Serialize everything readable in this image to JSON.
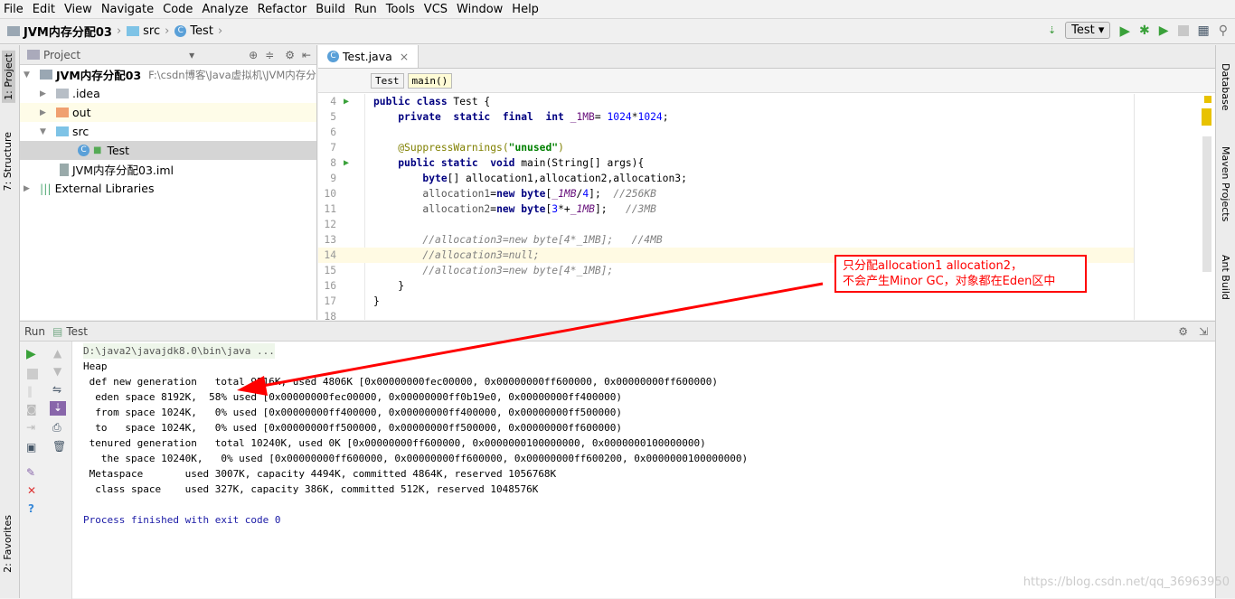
{
  "menu": [
    "File",
    "Edit",
    "View",
    "Navigate",
    "Code",
    "Analyze",
    "Refactor",
    "Build",
    "Run",
    "Tools",
    "VCS",
    "Window",
    "Help"
  ],
  "breadcrumb": [
    "JVM内存分配03",
    "src",
    "Test"
  ],
  "run_config": "Test",
  "left_tabs": [
    "1: Project",
    "7: Structure",
    "2: Favorites"
  ],
  "right_tabs": [
    "Database",
    "Maven Projects",
    "Ant Build"
  ],
  "project": {
    "title": "Project",
    "root": "JVM内存分配03",
    "root_path": "F:\\csdn博客\\Java虚拟机\\JVM内存分",
    "items": [
      ".idea",
      "out",
      "src",
      "Test",
      "JVM内存分配03.iml",
      "External Libraries"
    ]
  },
  "editor": {
    "tab": "Test.java",
    "crumbs": [
      "Test",
      "main()"
    ],
    "lines": [
      {
        "n": "4",
        "run": true,
        "seg": [
          [
            "kw",
            "public class "
          ],
          [
            "",
            "Test {"
          ]
        ]
      },
      {
        "n": "5",
        "seg": [
          [
            "",
            "    "
          ],
          [
            "kw",
            "private  static  final  int "
          ],
          [
            "fld",
            "_1MB"
          ],
          [
            "",
            "= "
          ],
          [
            "num",
            "1024"
          ],
          [
            "",
            "*"
          ],
          [
            "num",
            "1024"
          ],
          [
            "",
            ";"
          ]
        ]
      },
      {
        "n": "6",
        "seg": []
      },
      {
        "n": "7",
        "seg": [
          [
            "",
            "    "
          ],
          [
            "an",
            "@SuppressWarnings("
          ],
          [
            "str",
            "\"unused\""
          ],
          [
            "an",
            ")"
          ]
        ]
      },
      {
        "n": "8",
        "run": true,
        "seg": [
          [
            "",
            "    "
          ],
          [
            "kw",
            "public static  void "
          ],
          [
            "",
            "main(String[] args){"
          ]
        ]
      },
      {
        "n": "9",
        "seg": [
          [
            "",
            "        "
          ],
          [
            "kw",
            "byte"
          ],
          [
            "",
            "[] allocation1,allocation2,allocation3;"
          ]
        ]
      },
      {
        "n": "10",
        "seg": [
          [
            "",
            "        "
          ],
          [
            "gray",
            "allocation1"
          ],
          [
            "",
            "="
          ],
          [
            "kw",
            "new byte"
          ],
          [
            "",
            "["
          ],
          [
            "var",
            "_1MB"
          ],
          [
            "",
            "/"
          ],
          [
            "num",
            "4"
          ],
          [
            "",
            "];  "
          ],
          [
            "cm",
            "//256KB"
          ]
        ]
      },
      {
        "n": "11",
        "seg": [
          [
            "",
            "        "
          ],
          [
            "gray",
            "allocation2"
          ],
          [
            "",
            "="
          ],
          [
            "kw",
            "new byte"
          ],
          [
            "",
            "["
          ],
          [
            "num",
            "3"
          ],
          [
            "",
            "*+"
          ],
          [
            "var",
            "_1MB"
          ],
          [
            "",
            "];   "
          ],
          [
            "cm",
            "//3MB"
          ]
        ]
      },
      {
        "n": "12",
        "seg": []
      },
      {
        "n": "13",
        "seg": [
          [
            "",
            "        "
          ],
          [
            "cm",
            "//allocation3=new byte[4*_1MB];   //4MB"
          ]
        ]
      },
      {
        "n": "14",
        "hl": true,
        "seg": [
          [
            "",
            "        "
          ],
          [
            "cm",
            "//allocation3=null;"
          ]
        ]
      },
      {
        "n": "15",
        "seg": [
          [
            "",
            "        "
          ],
          [
            "cm",
            "//allocation3=new byte[4*_1MB];"
          ]
        ]
      },
      {
        "n": "16",
        "seg": [
          [
            "",
            "    }"
          ]
        ]
      },
      {
        "n": "17",
        "seg": [
          [
            "",
            "}"
          ]
        ]
      },
      {
        "n": "18",
        "seg": []
      }
    ]
  },
  "run": {
    "title": "Run",
    "config": "Test",
    "console": [
      "D:\\java2\\javajdk8.0\\bin\\java ...",
      "Heap",
      " def new generation   total 9216K, used 4806K [0x00000000fec00000, 0x00000000ff600000, 0x00000000ff600000)",
      "  eden space 8192K,  58% used [0x00000000fec00000, 0x00000000ff0b19e0, 0x00000000ff400000)",
      "  from space 1024K,   0% used [0x00000000ff400000, 0x00000000ff400000, 0x00000000ff500000)",
      "  to   space 1024K,   0% used [0x00000000ff500000, 0x00000000ff500000, 0x00000000ff600000)",
      " tenured generation   total 10240K, used 0K [0x00000000ff600000, 0x0000000100000000, 0x0000000100000000)",
      "   the space 10240K,   0% used [0x00000000ff600000, 0x00000000ff600000, 0x00000000ff600200, 0x0000000100000000)",
      " Metaspace       used 3007K, capacity 4494K, committed 4864K, reserved 1056768K",
      "  class space    used 327K, capacity 386K, committed 512K, reserved 1048576K",
      "",
      "Process finished with exit code 0"
    ]
  },
  "annotation": [
    "只分配allocation1 allocation2，",
    "不会产生Minor GC，对象都在Eden区中"
  ],
  "watermark": "https://blog.csdn.net/qq_36963950",
  "colors": {
    "annotation": "#ff0000",
    "run_green": "#3aa13a",
    "current_line": "#fffae3"
  }
}
